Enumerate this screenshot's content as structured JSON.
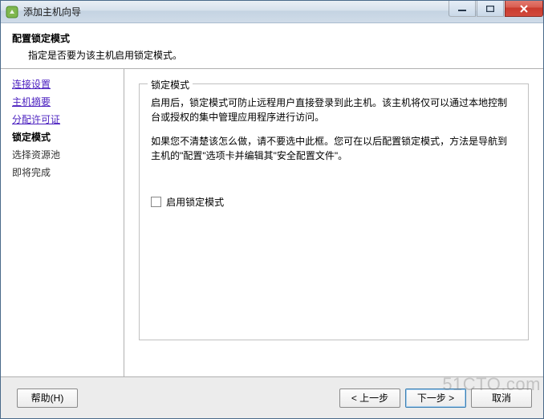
{
  "window": {
    "title": "添加主机向导"
  },
  "header": {
    "title": "配置锁定模式",
    "subtitle": "指定是否要为该主机启用锁定模式。"
  },
  "sidebar": {
    "steps": [
      {
        "label": "连接设置",
        "state": "link"
      },
      {
        "label": "主机摘要",
        "state": "link"
      },
      {
        "label": "分配许可证",
        "state": "link"
      },
      {
        "label": "锁定模式",
        "state": "current"
      },
      {
        "label": "选择资源池",
        "state": "future"
      },
      {
        "label": "即将完成",
        "state": "future"
      }
    ]
  },
  "group": {
    "legend": "锁定模式",
    "para1": "启用后，锁定模式可防止远程用户直接登录到此主机。该主机将仅可以通过本地控制台或授权的集中管理应用程序进行访问。",
    "para2": "如果您不清楚该怎么做，请不要选中此框。您可在以后配置锁定模式，方法是导航到主机的\"配置\"选项卡并编辑其\"安全配置文件\"。",
    "checkbox_label": "启用锁定模式",
    "checked": false
  },
  "footer": {
    "help": "帮助(H)",
    "back": "< 上一步",
    "next": "下一步 >",
    "cancel": "取消"
  },
  "watermark": "51CTO.com"
}
